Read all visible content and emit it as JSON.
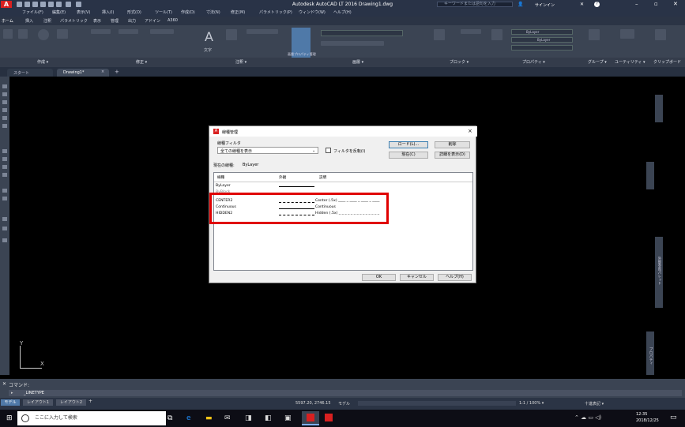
{
  "titlebar": {
    "title": "Autodesk AutoCAD LT 2016   Drawing1.dwg",
    "search_placeholder": "キーワードまたは語句を入力",
    "signin": "サインイン",
    "help": "?"
  },
  "menubar": [
    "ファイル(F)",
    "編集(E)",
    "表示(V)",
    "挿入(I)",
    "形式(O)",
    "ツール(T)",
    "作成(D)",
    "寸法(N)",
    "修正(M)",
    "パラメトリック(P)",
    "ウィンドウ(W)",
    "ヘルプ(H)"
  ],
  "ribbon_tabs": [
    "ホーム",
    "挿入",
    "注釈",
    "パラメトリック",
    "表示",
    "管理",
    "出力",
    "アドイン",
    "A360"
  ],
  "ribbon_panels": [
    "作成 ▾",
    "修正 ▾",
    "注釈 ▾",
    "画層 ▾",
    "ブロック ▾",
    "プロパティ ▾",
    "グループ ▾",
    "ユーティリティ ▾",
    "クリップボード"
  ],
  "ribbon_labels": {
    "text": "文字",
    "layer_properties": "画層プロパティ管理",
    "bylayer": "ByLayer"
  },
  "doc_tabs": {
    "start": "スタート",
    "drawing": "Drawing1*",
    "new": "+"
  },
  "dialog": {
    "title": "線種管理",
    "filter_label": "線種フィルタ",
    "filter_value": "全ての線種を表示",
    "invert_label": "フィルタを反転(I)",
    "current_label": "現在の線種:",
    "current_value": "ByLayer",
    "buttons": {
      "load": "ロード(L)...",
      "delete": "削除",
      "current": "現在(C)",
      "details": "詳細を表示(D)",
      "ok": "OK",
      "cancel": "キャンセル",
      "help": "ヘルプ(H)"
    },
    "columns": {
      "linetype": "線種",
      "appearance": "外観",
      "description": "説明"
    },
    "rows": [
      {
        "name": "ByLayer",
        "description": ""
      },
      {
        "name": "ByBlock",
        "description": ""
      },
      {
        "name": "CENTER2",
        "description": "Center (.5x) ____ _ ____ _ ____ _ ____"
      },
      {
        "name": "Continuous",
        "description": "Continuous"
      },
      {
        "name": "HIDDEN2",
        "description": "Hidden (.5x) _ _ _ _ _ _ _ _ _ _ _ _ _ _"
      }
    ]
  },
  "command": {
    "label": "コマンド:",
    "input": "_LINETYPE"
  },
  "layout_tabs": [
    "モデル",
    "レイアウト1",
    "レイアウト2",
    "+"
  ],
  "status": {
    "coords": "5597.20, 2746.15",
    "mode": "モデル",
    "scale": "1:1 / 100% ▾",
    "unit": "十進表記 ▾"
  },
  "palette_labels": {
    "properties": "プロパティ",
    "tool": "外部参照パレット"
  },
  "taskbar": {
    "search": "ここに入力して検索",
    "time": "12:35",
    "date": "2018/12/25"
  },
  "ucs": {
    "x": "X",
    "y": "Y"
  }
}
